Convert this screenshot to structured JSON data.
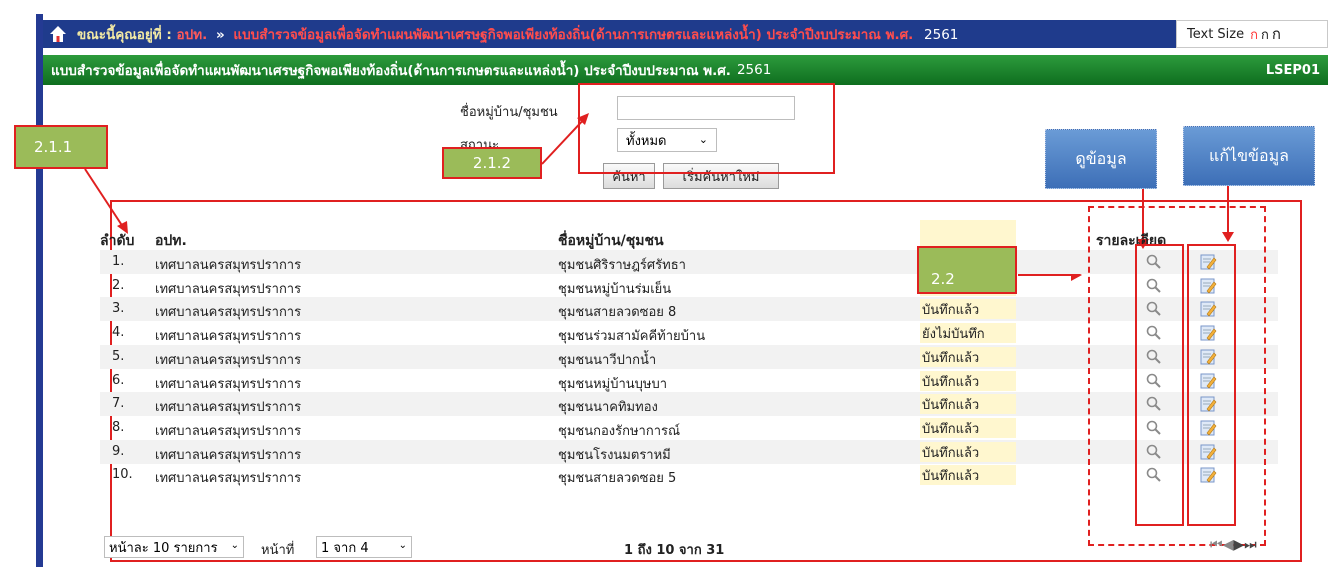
{
  "breadcrumb": {
    "prefix": "ขณะนี้คุณอยู่ที่ :",
    "link": "อปท.",
    "separator": "»",
    "current": "แบบสำรวจข้อมูลเพื่อจัดทำแผนพัฒนาเศรษฐกิจพอเพียงท้องถิ่น(ด้านการเกษตรและแหล่งน้ำ) ประจำปีงบประมาณ พ.ศ.",
    "year": "2561"
  },
  "text_size": {
    "label": "Text Size",
    "options": [
      "ก",
      "ก",
      "ก"
    ]
  },
  "header": {
    "title": "แบบสำรวจข้อมูลเพื่อจัดทำแผนพัฒนาเศรษฐกิจพอเพียงท้องถิ่น(ด้านการเกษตรและแหล่งน้ำ) ประจำปีงบประมาณ พ.ศ.",
    "year": "2561",
    "code": "LSEP01"
  },
  "search": {
    "village_label": "ชื่อหมู่บ้าน/ชุมชน",
    "village_value": "",
    "status_label": "สถานะ",
    "status_value": "ทั้งหมด",
    "search_button": "ค้นหา",
    "reset_button": "เริ่มค้นหาใหม่"
  },
  "annotations": {
    "a211": "2.1.1",
    "a212": "2.1.2",
    "a22": "2.2",
    "view": "ดูข้อมูล",
    "edit": "แก้ไขข้อมูล"
  },
  "table": {
    "headers": {
      "no": "ลำดับ",
      "org": "อปท.",
      "village": "ชื่อหมู่บ้าน/ชุมชน",
      "detail": "รายละเอียด"
    },
    "rows": [
      {
        "no": "1.",
        "org": "เทศบาลนครสมุทรปราการ",
        "village": "ชุมชนศิริราษฎร์ศรัทธา",
        "status": ""
      },
      {
        "no": "2.",
        "org": "เทศบาลนครสมุทรปราการ",
        "village": "ชุมชนหมู่บ้านร่มเย็น",
        "status": ""
      },
      {
        "no": "3.",
        "org": "เทศบาลนครสมุทรปราการ",
        "village": "ชุมชนสายลวดซอย 8",
        "status": "บันทึกแล้ว"
      },
      {
        "no": "4.",
        "org": "เทศบาลนครสมุทรปราการ",
        "village": "ชุมชนร่วมสามัคคีท้ายบ้าน",
        "status": "ยังไม่บันทึก"
      },
      {
        "no": "5.",
        "org": "เทศบาลนครสมุทรปราการ",
        "village": "ชุมชนนาวีปากน้ำ",
        "status": "บันทึกแล้ว"
      },
      {
        "no": "6.",
        "org": "เทศบาลนครสมุทรปราการ",
        "village": "ชุมชนหมู่บ้านบุษบา",
        "status": "บันทึกแล้ว"
      },
      {
        "no": "7.",
        "org": "เทศบาลนครสมุทรปราการ",
        "village": "ชุมชนนาคทิมทอง",
        "status": "บันทึกแล้ว"
      },
      {
        "no": "8.",
        "org": "เทศบาลนครสมุทรปราการ",
        "village": "ชุมชนกองรักษาการณ์",
        "status": "บันทึกแล้ว"
      },
      {
        "no": "9.",
        "org": "เทศบาลนครสมุทรปราการ",
        "village": "ชุมชนโรงนมตราหมี",
        "status": "บันทึกแล้ว"
      },
      {
        "no": "10.",
        "org": "เทศบาลนครสมุทรปราการ",
        "village": "ชุมชนสายลวดซอย 5",
        "status": "บันทึกแล้ว"
      }
    ]
  },
  "pager": {
    "per_page": "หน้าละ 10 รายการ",
    "page_label": "หน้าที่",
    "page_value": "1 จาก 4",
    "range": "1 ถึง 10 จาก 31"
  }
}
